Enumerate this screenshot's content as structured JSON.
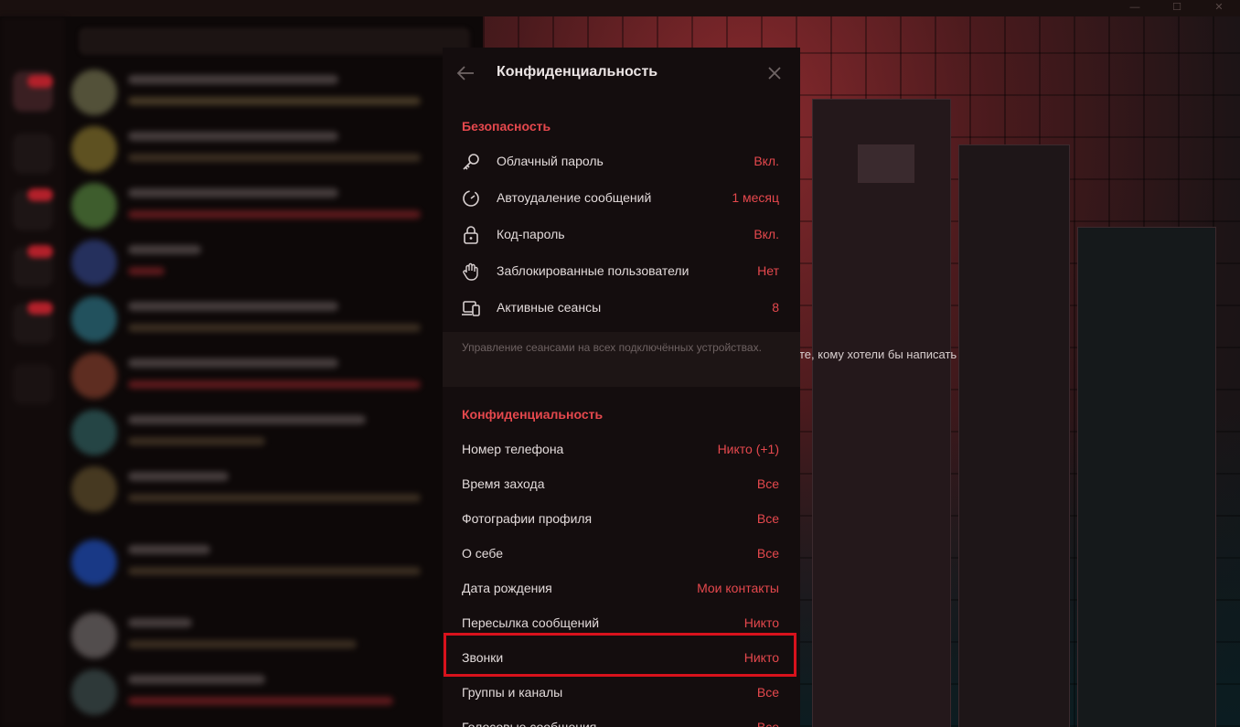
{
  "colors": {
    "accent": "#e5484d",
    "panel_bg": "#140d0e",
    "highlight": "#d8121c"
  },
  "window": {
    "minimize_icon": "—",
    "maximize_icon": "☐",
    "close_icon": "✕"
  },
  "background": {
    "empty_chat_hint": "те, кому хотели бы написать"
  },
  "settings_panel": {
    "title": "Конфиденциальность",
    "back_icon": "arrow-left-icon",
    "close_icon": "close-icon",
    "security_section": {
      "title": "Безопасность",
      "items": [
        {
          "icon": "key-icon",
          "label": "Облачный пароль",
          "value": "Вкл."
        },
        {
          "icon": "timer-icon",
          "label": "Автоудаление сообщений",
          "value": "1 месяц"
        },
        {
          "icon": "lock-icon",
          "label": "Код-пароль",
          "value": "Вкл."
        },
        {
          "icon": "hand-icon",
          "label": "Заблокированные пользователи",
          "value": "Нет"
        },
        {
          "icon": "devices-icon",
          "label": "Активные сеансы",
          "value": "8"
        }
      ],
      "note": "Управление сеансами на всех подключённых устройствах."
    },
    "privacy_section": {
      "title": "Конфиденциальность",
      "items": [
        {
          "label": "Номер телефона",
          "value": "Никто (+1)"
        },
        {
          "label": "Время захода",
          "value": "Все"
        },
        {
          "label": "Фотографии профиля",
          "value": "Все"
        },
        {
          "label": "О себе",
          "value": "Все"
        },
        {
          "label": "Дата рождения",
          "value": "Мои контакты"
        },
        {
          "label": "Пересылка сообщений",
          "value": "Никто"
        },
        {
          "label": "Звонки",
          "value": "Никто"
        },
        {
          "label": "Группы и каналы",
          "value": "Все"
        },
        {
          "label": "Голосовые сообщения",
          "value": "Все"
        }
      ]
    }
  }
}
